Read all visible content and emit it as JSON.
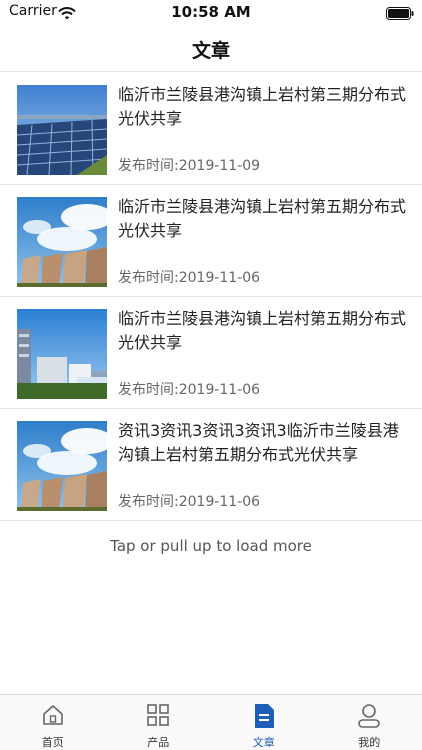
{
  "status": {
    "carrier": "Carrier",
    "time": "10:58 AM"
  },
  "header": {
    "title": "文章"
  },
  "articles": [
    {
      "title": "临沂市兰陵县港沟镇上岩村第三期分布式光伏共享",
      "date": "发布时间:2019-11-09",
      "image": "solar-panels"
    },
    {
      "title": "临沂市兰陵县港沟镇上岩村第五期分布式光伏共享",
      "date": "发布时间:2019-11-06",
      "image": "cooling-towers"
    },
    {
      "title": "临沂市兰陵县港沟镇上岩村第五期分布式光伏共享",
      "date": "发布时间:2019-11-06",
      "image": "city-buildings"
    },
    {
      "title": "资讯3资讯3资讯3资讯3临沂市兰陵县港沟镇上岩村第五期分布式光伏共享",
      "date": "发布时间:2019-11-06",
      "image": "cooling-towers"
    }
  ],
  "load_more": "Tap or pull up to load more",
  "tabs": [
    {
      "label": "首页",
      "icon": "home-icon",
      "active": false
    },
    {
      "label": "产品",
      "icon": "grid-icon",
      "active": false
    },
    {
      "label": "文章",
      "icon": "document-icon",
      "active": true
    },
    {
      "label": "我的",
      "icon": "user-icon",
      "active": false
    }
  ],
  "colors": {
    "accent": "#1d5fb8",
    "divider": "#e3e3e3",
    "date_text": "#666666"
  }
}
